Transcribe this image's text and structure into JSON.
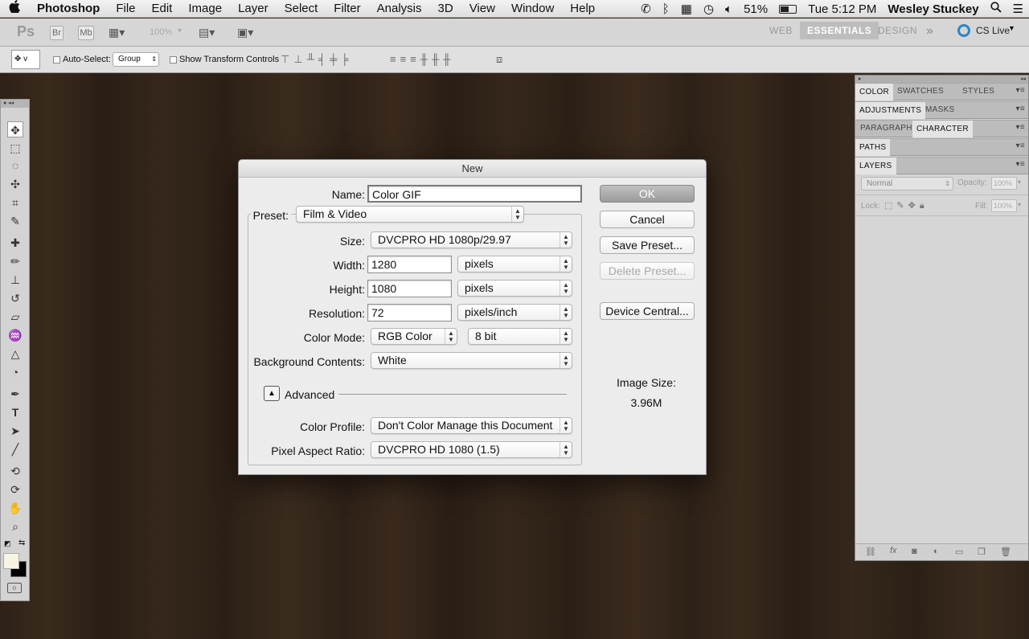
{
  "menubar": {
    "app": "Photoshop",
    "items": [
      "File",
      "Edit",
      "Image",
      "Layer",
      "Select",
      "Filter",
      "Analysis",
      "3D",
      "View",
      "Window",
      "Help"
    ],
    "battery": "51%",
    "clock": "Tue 5:12 PM",
    "user": "Wesley Stuckey"
  },
  "appbar": {
    "logo": "Ps",
    "br": "Br",
    "mb": "Mb",
    "zoom": "100%",
    "workspaces": [
      "WEB",
      "ESSENTIALS",
      "DESIGN"
    ],
    "cs_live": "CS Live"
  },
  "options": {
    "tool_indicator": "v",
    "auto_select_label": "Auto-Select:",
    "auto_select_value": "Group",
    "transform_label": "Show Transform Controls"
  },
  "panels": {
    "row1": [
      "COLOR",
      "SWATCHES",
      "STYLES"
    ],
    "row2": [
      "ADJUSTMENTS",
      "MASKS"
    ],
    "row3": [
      "PARAGRAPH",
      "CHARACTER"
    ],
    "row4": [
      "PATHS"
    ],
    "row5": [
      "LAYERS"
    ],
    "blend_mode": "Normal",
    "opacity_label": "Opacity:",
    "opacity_value": "100%",
    "lock_label": "Lock:",
    "fill_label": "Fill:",
    "fill_value": "100%"
  },
  "dialog": {
    "title": "New",
    "name_label": "Name:",
    "name_value": "Color GIF",
    "preset_label": "Preset:",
    "preset_value": "Film & Video",
    "size_label": "Size:",
    "size_value": "DVCPRO HD 1080p/29.97",
    "width_label": "Width:",
    "width_value": "1280",
    "width_unit": "pixels",
    "height_label": "Height:",
    "height_value": "1080",
    "height_unit": "pixels",
    "resolution_label": "Resolution:",
    "resolution_value": "72",
    "resolution_unit": "pixels/inch",
    "color_mode_label": "Color Mode:",
    "color_mode_value": "RGB Color",
    "bit_depth": "8 bit",
    "background_label": "Background Contents:",
    "background_value": "White",
    "advanced_label": "Advanced",
    "color_profile_label": "Color Profile:",
    "color_profile_value": "Don't Color Manage this Document",
    "pixel_aspect_label": "Pixel Aspect Ratio:",
    "pixel_aspect_value": "DVCPRO HD 1080 (1.5)",
    "buttons": {
      "ok": "OK",
      "cancel": "Cancel",
      "save_preset": "Save Preset...",
      "delete_preset": "Delete Preset...",
      "device_central": "Device Central..."
    },
    "image_size_label": "Image Size:",
    "image_size_value": "3.96M"
  },
  "colors": {
    "foreground": "#f7f4e4",
    "background": "#000000"
  }
}
